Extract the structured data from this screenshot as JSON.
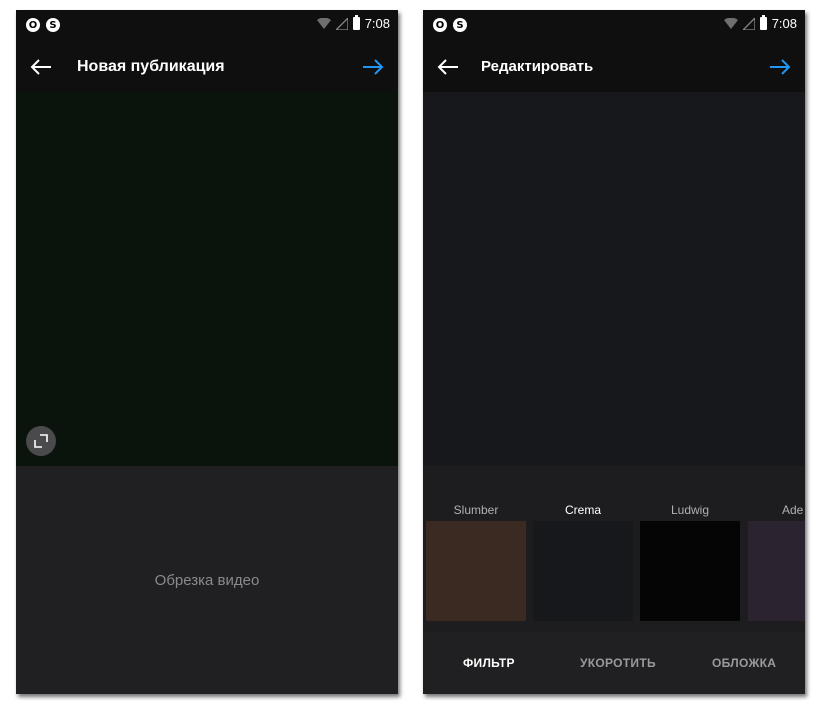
{
  "status_bar": {
    "time": "7:08",
    "left_icons": [
      "opera-icon",
      "shazam-icon"
    ],
    "right_icons": [
      "wifi-icon",
      "signal-icon",
      "battery-icon"
    ]
  },
  "left_screen": {
    "title": "Новая публикация",
    "back_icon": "arrow-left-icon",
    "next_icon": "arrow-right-icon",
    "expand_icon": "expand-icon",
    "trim_label": "Обрезка видео"
  },
  "right_screen": {
    "title": "Редактировать",
    "back_icon": "arrow-left-icon",
    "next_icon": "arrow-right-icon",
    "filters": [
      {
        "name": "Slumber",
        "color": "#3a2a22",
        "selected": false
      },
      {
        "name": "Crema",
        "color": "#16181b",
        "selected": true
      },
      {
        "name": "Ludwig",
        "color": "#050505",
        "selected": false
      },
      {
        "name": "Ade",
        "color": "#2b2430",
        "selected": false
      }
    ],
    "tabs": [
      {
        "label": "ФИЛЬТР",
        "active": true
      },
      {
        "label": "УКОРОТИТЬ",
        "active": false
      },
      {
        "label": "ОБЛОЖКА",
        "active": false
      }
    ]
  },
  "colors": {
    "accent": "#2196f3",
    "bar_bg": "#0f0f10",
    "panel_bg": "#202022"
  }
}
